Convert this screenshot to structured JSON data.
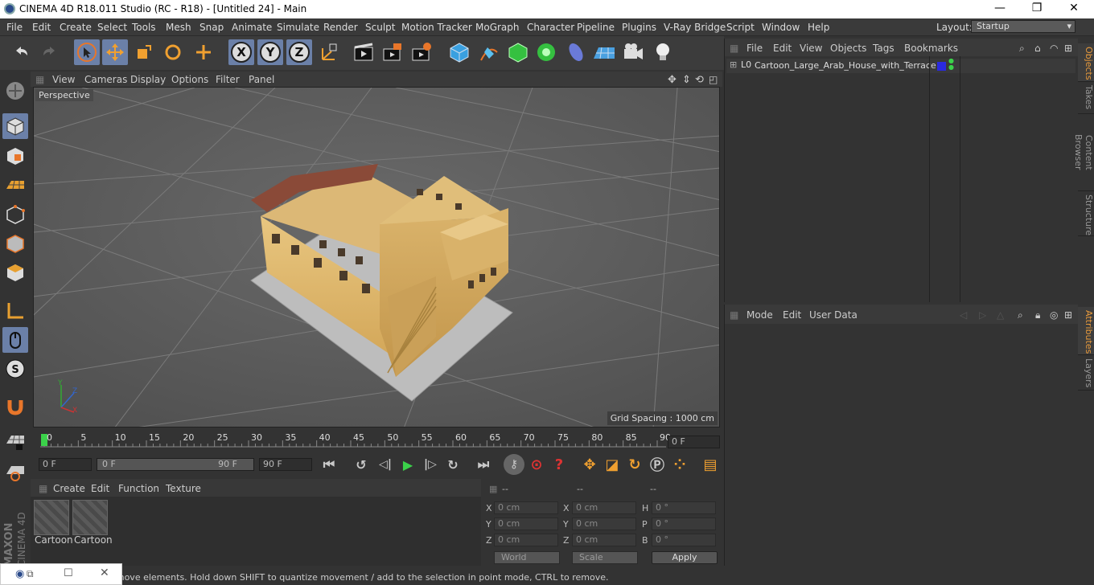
{
  "window": {
    "title": "CINEMA 4D R18.011 Studio (RC - R18) - [Untitled 24] - Main",
    "minimize": "—",
    "maximize": "❐",
    "close": "✕"
  },
  "menu": [
    "File",
    "Edit",
    "Create",
    "Select",
    "Tools",
    "Mesh",
    "Snap",
    "Animate",
    "Simulate",
    "Render",
    "Sculpt",
    "Motion Tracker",
    "MoGraph",
    "Character",
    "Pipeline",
    "Plugins",
    "V-Ray Bridge",
    "Script",
    "Window",
    "Help"
  ],
  "layout": {
    "label": "Layout:",
    "value": "Startup"
  },
  "viewport": {
    "menu": [
      "View",
      "Cameras",
      "Display",
      "Options",
      "Filter",
      "Panel"
    ],
    "camera_label": "Perspective",
    "grid_spacing": "Grid Spacing : 1000 cm"
  },
  "timeline": {
    "ticks": [
      "0",
      "5",
      "10",
      "15",
      "20",
      "25",
      "30",
      "35",
      "40",
      "45",
      "50",
      "55",
      "60",
      "65",
      "70",
      "75",
      "80",
      "85",
      "90"
    ],
    "current_frame": "0 F"
  },
  "playback": {
    "start": "0 F",
    "range_start": "0 F",
    "range_end": "90 F",
    "end": "90 F"
  },
  "materials": {
    "menu": [
      "Create",
      "Edit",
      "Function",
      "Texture"
    ],
    "items": [
      "Cartoon",
      "Cartoon"
    ]
  },
  "coordinates": {
    "headers": [
      "--",
      "--",
      "--"
    ],
    "pos_labels": [
      "X",
      "Y",
      "Z"
    ],
    "pos": [
      "0 cm",
      "0 cm",
      "0 cm"
    ],
    "size_labels": [
      "X",
      "Y",
      "Z"
    ],
    "size": [
      "0 cm",
      "0 cm",
      "0 cm"
    ],
    "rot_labels": [
      "H",
      "P",
      "B"
    ],
    "rot": [
      "0 °",
      "0 °",
      "0 °"
    ],
    "mode1": "World",
    "mode2": "Scale",
    "apply": "Apply"
  },
  "status": {
    "text": "Move: Click and drag to move elements. Hold down SHIFT to quantize movement / add to the selection in point mode, CTRL to remove."
  },
  "objects": {
    "menu": [
      "File",
      "Edit",
      "View",
      "Objects",
      "Tags",
      "Bookmarks"
    ],
    "item": {
      "layer_label": "L0",
      "name": "Cartoon_Large_Arab_House_with_Terrace",
      "color": "#2a2adf"
    }
  },
  "attributes": {
    "menu": [
      "Mode",
      "Edit",
      "User Data"
    ]
  },
  "side_tabs": [
    "Objects",
    "Takes",
    "Content Browser",
    "Structure",
    "Attributes",
    "Layers"
  ],
  "colors": {
    "accent": "#e89a3c",
    "selection": "#6b80a8"
  }
}
